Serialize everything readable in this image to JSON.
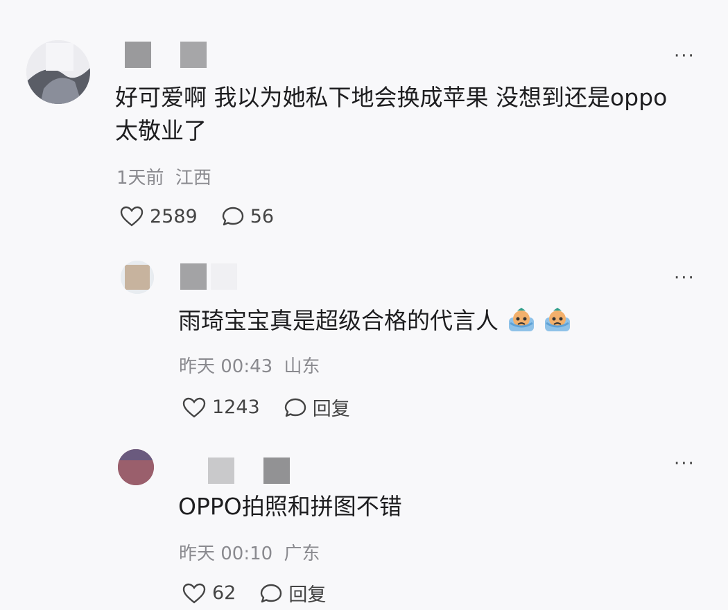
{
  "comments": [
    {
      "text_line1": "好可爱啊 我以为她私下地会换成苹果 没想到还是oppo",
      "text_line2": "太敬业了",
      "time": "1天前",
      "location": "江西",
      "likes": "2589",
      "replies": "56",
      "more": "···"
    },
    {
      "text": "雨琦宝宝真是超级合格的代言人",
      "time": "昨天 00:43",
      "location": "山东",
      "likes": "1243",
      "reply_label": "回复",
      "more": "···",
      "emoji_count": 2
    },
    {
      "text": "OPPO拍照和拼图不错",
      "time": "昨天 00:10",
      "location": "广东",
      "likes": "62",
      "reply_label": "回复",
      "more": "···"
    }
  ],
  "colors": {
    "background": "#f8f8fa",
    "text": "#1d1d1f",
    "meta": "#8a8a8f",
    "icon": "#444444"
  },
  "icons": [
    "heart-icon",
    "comment-bubble-icon",
    "more-icon",
    "crying-emoji-icon"
  ]
}
